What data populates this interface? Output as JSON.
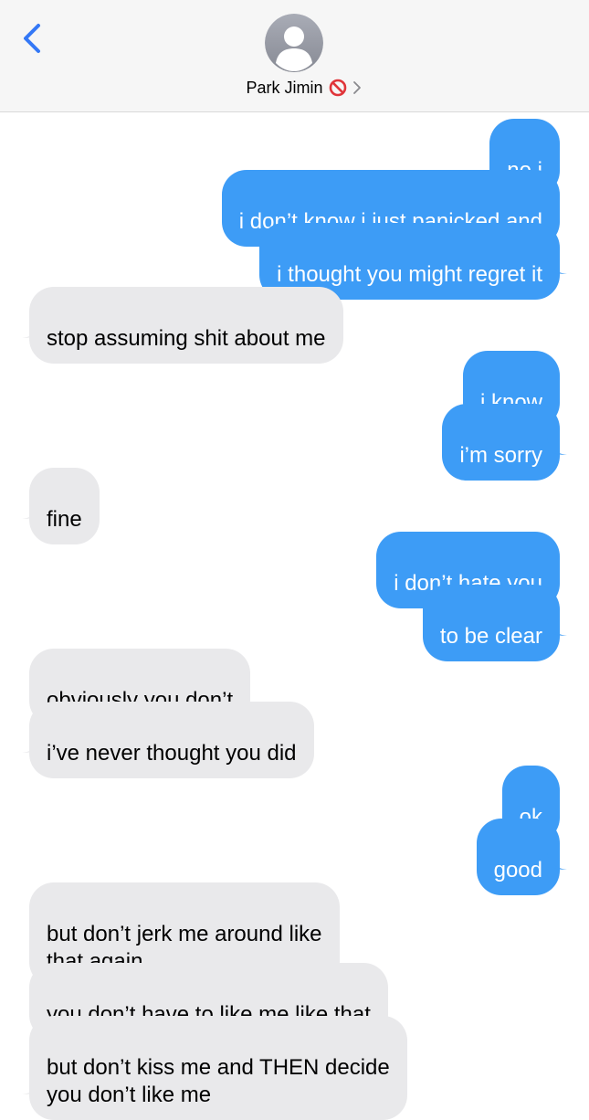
{
  "header": {
    "contact_name": "Park Jimin",
    "status_icon": "no-entry-icon",
    "accent_color": "#3478f6"
  },
  "messages": [
    {
      "from": "me",
      "text": "no i"
    },
    {
      "from": "me",
      "text": "i don’t know i just panicked and"
    },
    {
      "from": "me",
      "text": "i thought you might regret it"
    },
    {
      "from": "them",
      "text": "stop assuming shit about me"
    },
    {
      "from": "me",
      "text": "i know"
    },
    {
      "from": "me",
      "text": "i’m sorry"
    },
    {
      "from": "them",
      "text": "fine"
    },
    {
      "from": "me",
      "text": "i don’t hate you"
    },
    {
      "from": "me",
      "text": "to be clear"
    },
    {
      "from": "them",
      "text": "obviously you don’t"
    },
    {
      "from": "them",
      "text": "i’ve never thought you did"
    },
    {
      "from": "me",
      "text": "ok"
    },
    {
      "from": "me",
      "text": "good"
    },
    {
      "from": "them",
      "text": "but don’t jerk me around like\nthat again"
    },
    {
      "from": "them",
      "text": "you don’t have to like me like that"
    },
    {
      "from": "them",
      "text": "but don’t kiss me and THEN decide\nyou don’t like me"
    }
  ],
  "colors": {
    "sent_bubble": "#3d9cf6",
    "received_bubble": "#e9e9eb",
    "header_bg": "#f6f6f6"
  }
}
